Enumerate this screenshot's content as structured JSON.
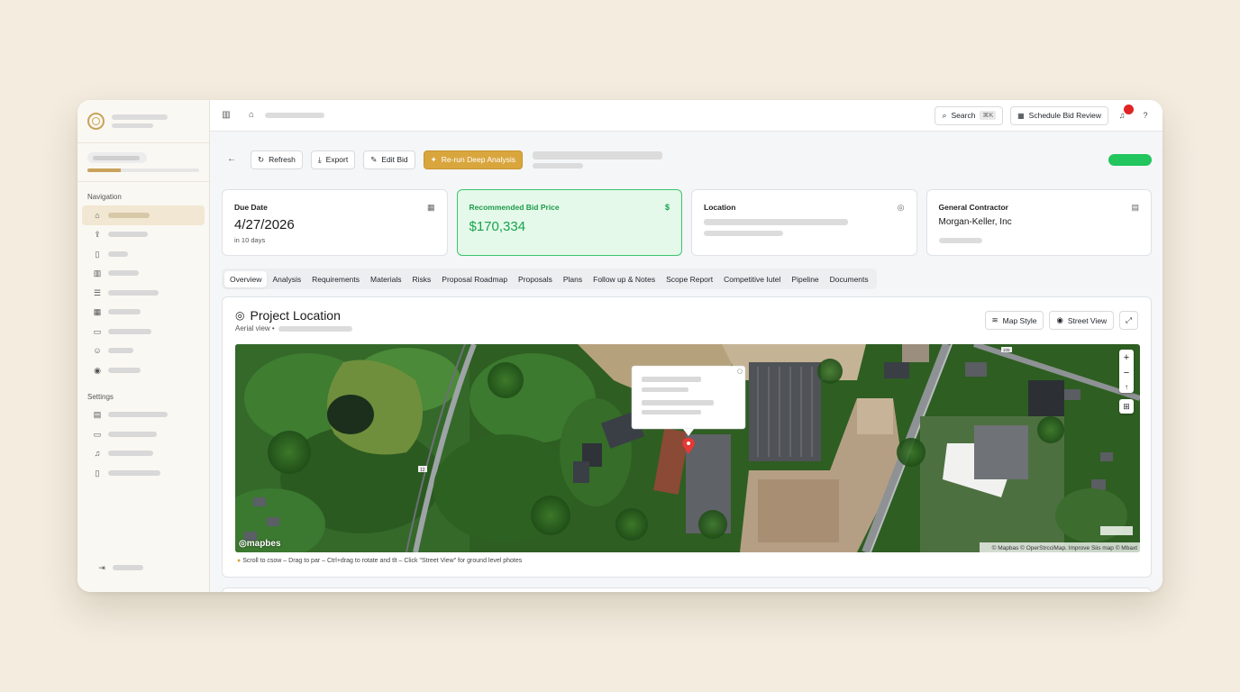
{
  "topbar": {
    "search_label": "Search",
    "search_kbd": "⌘K",
    "schedule_label": "Schedule Bid Review"
  },
  "sidebar": {
    "nav_section": "Navigation",
    "settings_section": "Settings",
    "org_progress": 0.3
  },
  "actions": {
    "refresh": "Refresh",
    "export": "Export",
    "edit_bid": "Edit Bid",
    "rerun": "Re-run Deep Analysis"
  },
  "cards": {
    "due": {
      "label": "Due Date",
      "value": "4/27/2026",
      "sub": "in 10 days"
    },
    "price": {
      "label": "Recommended Bid Price",
      "value": "$170,334",
      "icon": "$"
    },
    "location": {
      "label": "Location"
    },
    "contractor": {
      "label": "General Contractor",
      "value": "Morgan-Keller, Inc"
    }
  },
  "tabs": [
    "Overview",
    "Analysis",
    "Requirements",
    "Materials",
    "Risks",
    "Proposal Roadmap",
    "Proposals",
    "Plans",
    "Follow up & Notes",
    "Scope Report",
    "Competitive Iutel",
    "Pipeline",
    "Documents"
  ],
  "panel": {
    "title": "Project Location",
    "subtitle": "Aerial view •",
    "map_style": "Map Style",
    "street_view": "Street View",
    "map_brand": "mapbes",
    "attribution": "© Mapbas © OperStrcciMap. Improve Siis map © Mbaxt",
    "road_label_1": "12",
    "road_label_2": "105",
    "note": "Scroll to csow – Drag to par – Ctrl+drag to rotate and tlt – Click \"Street View\" for ground level photes"
  },
  "colors": {
    "accent_gold": "#d9a63e",
    "price_green": "#16a34a",
    "status_green": "#22c55e",
    "notification_red": "#e02424"
  }
}
